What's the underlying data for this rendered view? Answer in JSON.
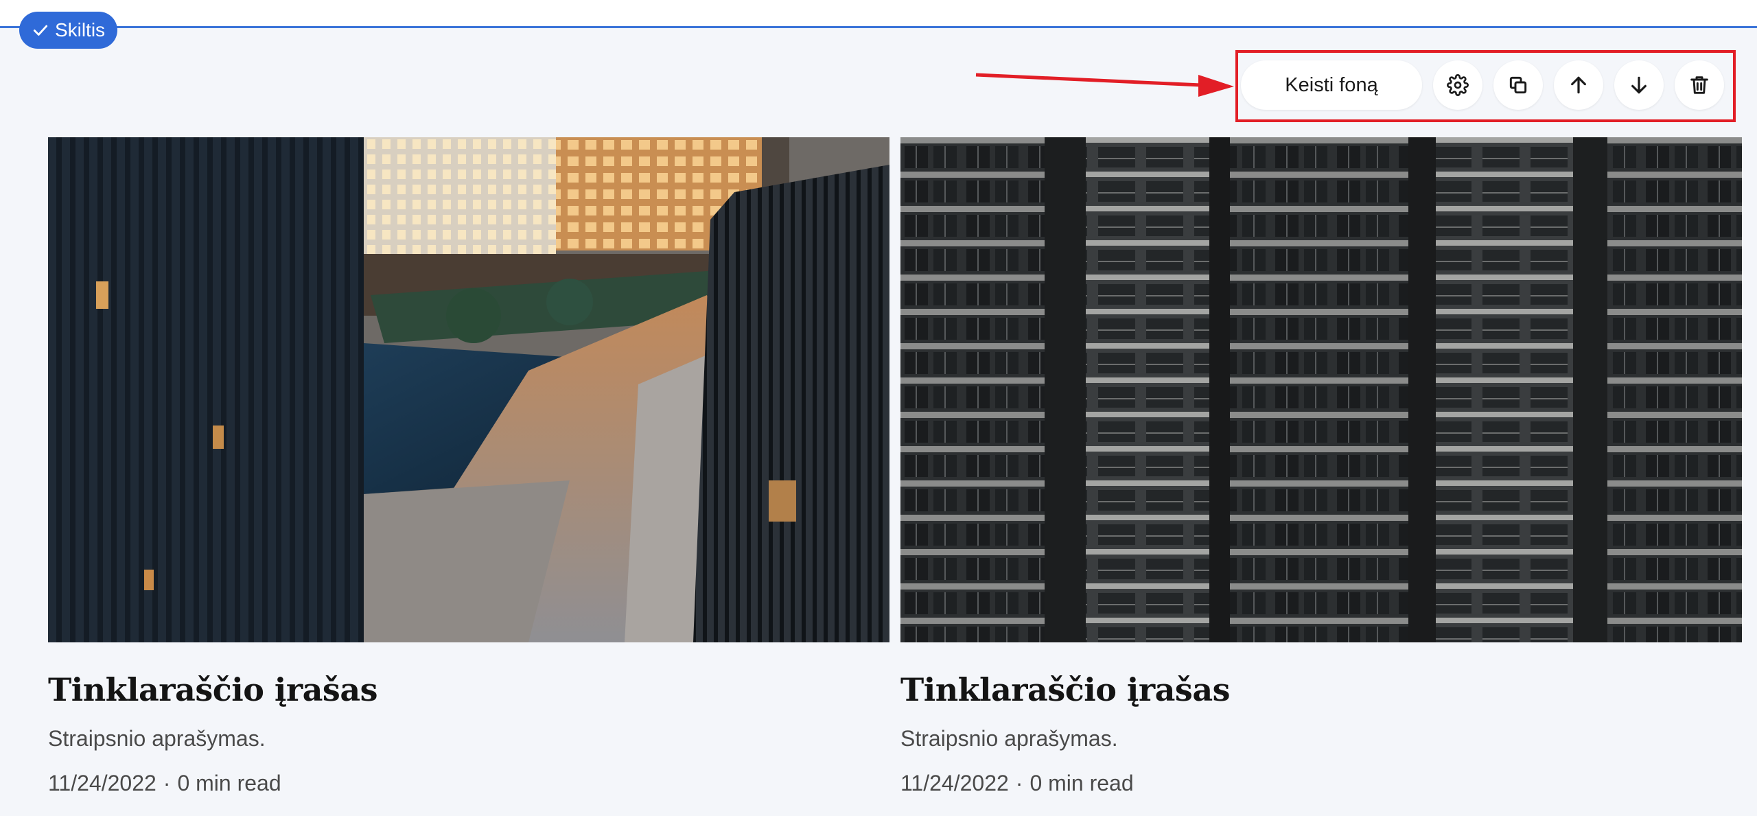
{
  "section": {
    "badge_label": "Skiltis"
  },
  "toolbar": {
    "change_background_label": "Keisti foną",
    "icons": [
      "settings-icon",
      "duplicate-icon",
      "arrow-up-icon",
      "arrow-down-icon",
      "trash-icon"
    ]
  },
  "colors": {
    "accent": "#2f6ad8",
    "highlight": "#e21e26",
    "background": "#f4f6fa"
  },
  "posts": [
    {
      "title": "Tinklaraščio įrašas",
      "description": "Straipsnio aprašymas.",
      "date": "11/24/2022",
      "separator": "·",
      "read_time": "0 min read"
    },
    {
      "title": "Tinklaraščio įrašas",
      "description": "Straipsnio aprašymas.",
      "date": "11/24/2022",
      "separator": "·",
      "read_time": "0 min read"
    }
  ]
}
